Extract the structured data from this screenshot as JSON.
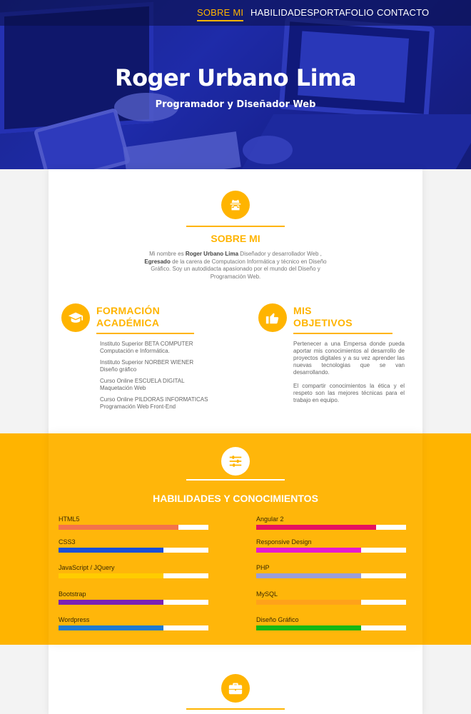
{
  "nav": {
    "items": [
      "SOBRE MI",
      "HABILIDADES",
      "PORTAFOLIO",
      "CONTACTO"
    ],
    "active": "SOBRE MI"
  },
  "hero": {
    "name": "Roger Urbano Lima",
    "subtitle": "Programador y Diseñador Web"
  },
  "about": {
    "title": "SOBRE MI",
    "icon": "spy-icon",
    "text_parts": {
      "p1": "Mi nombre es ",
      "name": "Roger Urbano Lima",
      "p2": " Diseñador y desarrollador Web ,",
      "bold2": "Egresado",
      "p3": " de la carera de Computacion Informática y técnico en Diseño Gráfico. Soy un autodidacta  apasionado por el mundo del Diseño y Programación Web."
    }
  },
  "education": {
    "title_line1": "FORMACIÓN",
    "title_line2": "ACADÉMICA",
    "icon": "graduation-cap-icon",
    "entries": [
      {
        "line1": "Instituto Superior BETA COMPUTER",
        "line2": "Computación e Informática."
      },
      {
        "line1": "Instituto Superior NORBER WIENER",
        "line2": "Diseño gráfico"
      },
      {
        "line1": "Curso Online ESCUELA DIGITAL",
        "line2": "Maquetación Web"
      },
      {
        "line1": "Curso Online PILDORAS INFORMATICAS",
        "line2": "Programación Web Front-End"
      }
    ]
  },
  "objectives": {
    "title_line1": "MIS",
    "title_line2": "OBJETIVOS",
    "icon": "thumbs-up-icon",
    "paragraphs": [
      "Pertenecer a una Empersa donde pueda aportar mis conocimientos  al desarrollo de proyectos digitales y a su vez aprender las nuevas tecnologias que se van desarrollando.",
      "El compartir conocimientos la ética y el respeto son las mejores técnicas para el trabajo en equipo."
    ]
  },
  "skills": {
    "title": "HABILIDADES Y CONOCIMIENTOS",
    "icon": "sliders-icon",
    "background": "#ffb400",
    "left": [
      {
        "name": "HTML5",
        "level": 0.8,
        "color": "#f4734a"
      },
      {
        "name": "CSS3",
        "level": 0.7,
        "color": "#1a4fd8"
      },
      {
        "name": "JavaScript / JQuery",
        "level": 0.7,
        "color": "#ffcc00"
      },
      {
        "name": "Bootstrap",
        "level": 0.7,
        "color": "#7b22b5"
      },
      {
        "name": "Wordpress",
        "level": 0.7,
        "color": "#1f7bd0"
      }
    ],
    "right": [
      {
        "name": "Angular 2",
        "level": 0.8,
        "color": "#e6125f"
      },
      {
        "name": "Responsive Design",
        "level": 0.7,
        "color": "#e61ad0"
      },
      {
        "name": "PHP",
        "level": 0.7,
        "color": "#9a9ed8"
      },
      {
        "name": "MySQL",
        "level": 0.7,
        "color": "#ffa21a"
      },
      {
        "name": "Diseño Gráfico",
        "level": 0.7,
        "color": "#14b814"
      }
    ]
  },
  "portfolio": {
    "icon": "briefcase-icon"
  },
  "colors": {
    "accent": "#ffb400",
    "hero_blue": "#2433b8"
  }
}
